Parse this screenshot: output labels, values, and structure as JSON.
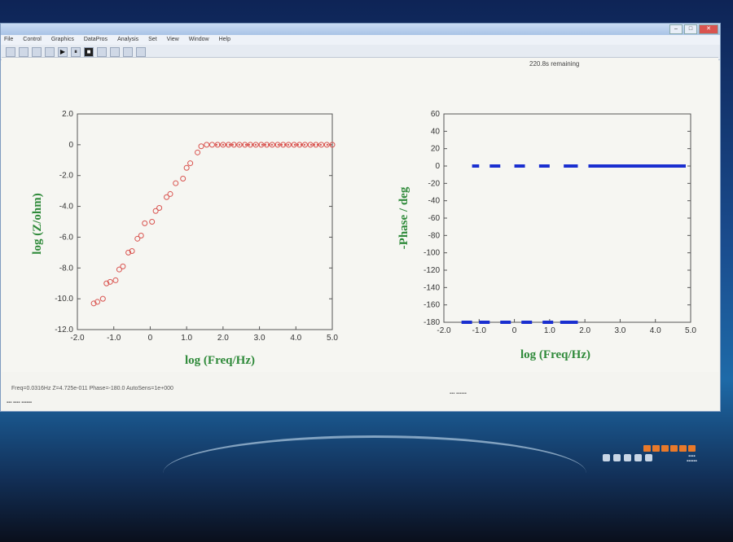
{
  "window": {
    "menu": [
      "File",
      "Control",
      "Graphics",
      "DataPros",
      "Analysis",
      "Set",
      "View",
      "Window",
      "Help"
    ],
    "remaining": "220.8s remaining"
  },
  "status": {
    "readout": "Freq=0.0316Hz  Z=4.725e-011  Phase=-180.0  AutoSens=1e+000"
  },
  "chart_data": [
    {
      "type": "scatter",
      "xlabel": "log (Freq/Hz)",
      "ylabel": "log (Z/ohm)",
      "xlim": [
        -2.0,
        5.0
      ],
      "ylim": [
        -12.0,
        2.0
      ],
      "xticks": [
        "-2.0",
        "-1.0",
        "0",
        "1.0",
        "2.0",
        "3.0",
        "4.0",
        "5.0"
      ],
      "yticks": [
        "2.0",
        "0",
        "-2.0",
        "-4.0",
        "-6.0",
        "-8.0",
        "-10.0",
        "-12.0"
      ],
      "marker_color": "#d9534f",
      "x": [
        -1.55,
        -1.45,
        -1.3,
        -1.2,
        -1.1,
        -0.95,
        -0.85,
        -0.75,
        -0.6,
        -0.5,
        -0.35,
        -0.25,
        -0.15,
        0.05,
        0.15,
        0.25,
        0.45,
        0.55,
        0.7,
        0.9,
        1.0,
        1.1,
        1.3,
        1.4,
        1.55,
        1.7,
        1.85,
        2.0,
        2.15,
        2.3,
        2.45,
        2.6,
        2.75,
        2.9,
        3.05,
        3.2,
        3.35,
        3.5,
        3.65,
        3.8,
        3.95,
        4.1,
        4.25,
        4.4,
        4.55,
        4.7,
        4.85,
        5.0
      ],
      "y": [
        -10.3,
        -10.2,
        -10.0,
        -9.0,
        -8.9,
        -8.8,
        -8.1,
        -7.9,
        -7.0,
        -6.9,
        -6.1,
        -5.9,
        -5.1,
        -5.0,
        -4.3,
        -4.1,
        -3.4,
        -3.2,
        -2.5,
        -2.2,
        -1.5,
        -1.2,
        -0.5,
        -0.1,
        0,
        0,
        0,
        0,
        0,
        0,
        0,
        0,
        0,
        0,
        0,
        0,
        0,
        0,
        0,
        0,
        0,
        0,
        0,
        0,
        0,
        0,
        0,
        0
      ]
    },
    {
      "type": "line",
      "xlabel": "log (Freq/Hz)",
      "ylabel": "-Phase / deg",
      "xlim": [
        -2.0,
        5.0
      ],
      "ylim": [
        -180,
        60
      ],
      "xticks": [
        "-2.0",
        "-1.0",
        "0",
        "1.0",
        "2.0",
        "3.0",
        "4.0",
        "5.0"
      ],
      "yticks": [
        "60",
        "40",
        "20",
        "0",
        "-20",
        "-40",
        "-60",
        "-80",
        "-100",
        "-120",
        "-140",
        "-160",
        "-180"
      ],
      "line_color": "#1a2fd0",
      "segments": [
        {
          "y": 0,
          "x": [
            [
              -1.2,
              -1.0
            ],
            [
              -0.7,
              -0.4
            ],
            [
              0,
              0.3
            ],
            [
              0.7,
              1.0
            ],
            [
              1.4,
              1.8
            ],
            [
              2.1,
              5.5
            ]
          ]
        },
        {
          "y": -180,
          "x": [
            [
              -1.5,
              -1.2
            ],
            [
              -1.0,
              -0.7
            ],
            [
              -0.4,
              -0.1
            ],
            [
              0.2,
              0.5
            ],
            [
              0.8,
              1.1
            ],
            [
              1.3,
              1.8
            ]
          ]
        }
      ]
    }
  ]
}
